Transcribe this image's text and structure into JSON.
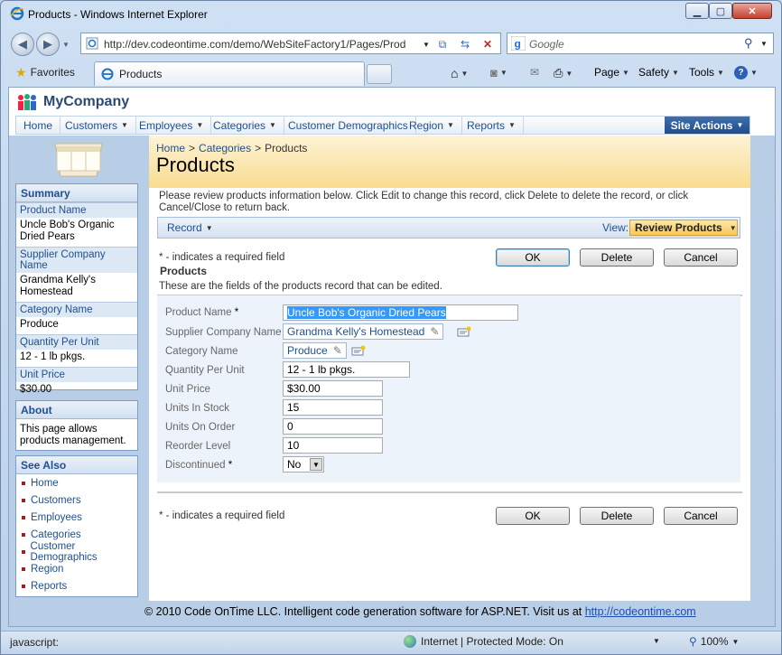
{
  "window": {
    "title": "Products - Windows Internet Explorer"
  },
  "address": {
    "url": "http://dev.codeontime.com/demo/WebSiteFactory1/Pages/Prod"
  },
  "search": {
    "placeholder": "Google"
  },
  "favorites_label": "Favorites",
  "tab": {
    "label": "Products"
  },
  "command_bar": {
    "page": "Page",
    "safety": "Safety",
    "tools": "Tools"
  },
  "site": {
    "name": "MyCompany"
  },
  "menu": {
    "items": [
      "Home",
      "Customers",
      "Employees",
      "Categories",
      "Customer Demographics",
      "Region",
      "Reports"
    ],
    "site_actions": "Site Actions"
  },
  "summary": {
    "title": "Summary",
    "fields": [
      {
        "label": "Product Name",
        "value": "Uncle Bob's Organic Dried Pears"
      },
      {
        "label": "Supplier Company Name",
        "value": "Grandma Kelly's Homestead"
      },
      {
        "label": "Category Name",
        "value": "Produce"
      },
      {
        "label": "Quantity Per Unit",
        "value": "12 - 1 lb pkgs."
      },
      {
        "label": "Unit Price",
        "value": "$30.00"
      }
    ]
  },
  "about": {
    "title": "About",
    "text": "This page allows products management."
  },
  "see_also": {
    "title": "See Also",
    "items": [
      "Home",
      "Customers",
      "Employees",
      "Categories",
      "Customer Demographics",
      "Region",
      "Reports"
    ]
  },
  "breadcrumb": {
    "home": "Home",
    "sep": ">",
    "categories": "Categories",
    "current": "Products"
  },
  "page_title": "Products",
  "instructions": "Please review products information below. Click Edit to change this record, click Delete to delete the record, or click Cancel/Close to return back.",
  "actionbar": {
    "record": "Record",
    "view_label": "View:",
    "view_value": "Review Products"
  },
  "required_note": "* - indicates a required field",
  "buttons": {
    "ok": "OK",
    "delete": "Delete",
    "cancel": "Cancel"
  },
  "category": {
    "title": "Products",
    "description": "These are the fields of the products record that can be edited."
  },
  "form": {
    "product_name": {
      "label": "Product Name",
      "value": "Uncle Bob's Organic Dried Pears"
    },
    "supplier": {
      "label": "Supplier Company Name",
      "value": "Grandma Kelly's Homestead"
    },
    "category": {
      "label": "Category Name",
      "value": "Produce"
    },
    "quantity": {
      "label": "Quantity Per Unit",
      "value": "12 - 1 lb pkgs."
    },
    "unit_price": {
      "label": "Unit Price",
      "value": "$30.00"
    },
    "units_in_stock": {
      "label": "Units In Stock",
      "value": "15"
    },
    "units_on_order": {
      "label": "Units On Order",
      "value": "0"
    },
    "reorder_level": {
      "label": "Reorder Level",
      "value": "10"
    },
    "discontinued": {
      "label": "Discontinued",
      "value": "No"
    },
    "required_mark": "*"
  },
  "footer": {
    "text": "© 2010 Code OnTime LLC. Intelligent code generation software for ASP.NET. Visit us at",
    "link": "http://codeontime.com"
  },
  "status": {
    "left": "javascript:",
    "zone": "Internet | Protected Mode: On",
    "zoom": "100%"
  }
}
